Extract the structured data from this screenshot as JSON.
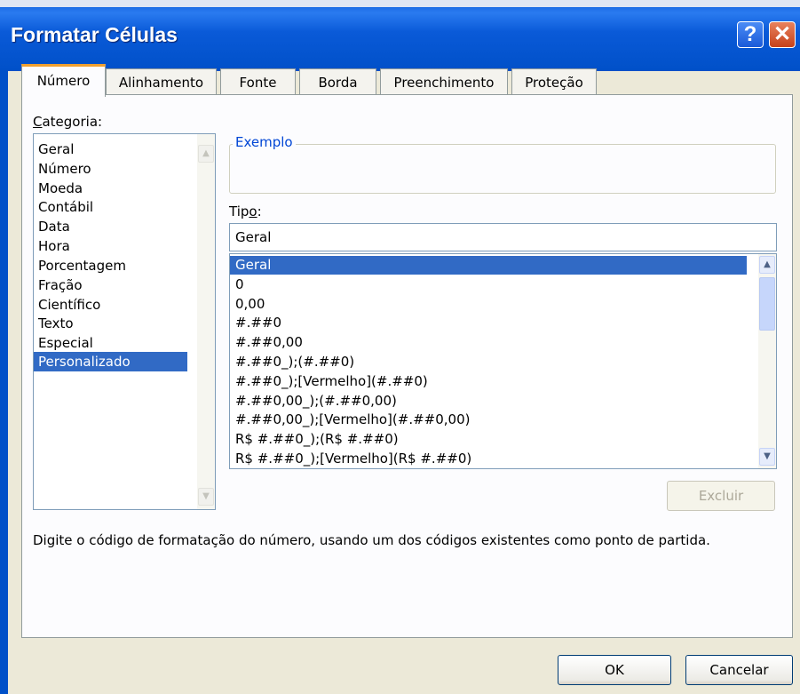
{
  "window": {
    "title": "Formatar Células",
    "help_glyph": "?",
    "close_glyph": "✕"
  },
  "tabs": [
    {
      "label": "Número",
      "active": true
    },
    {
      "label": "Alinhamento"
    },
    {
      "label": "Fonte"
    },
    {
      "label": "Borda"
    },
    {
      "label": "Preenchimento"
    },
    {
      "label": "Proteção"
    }
  ],
  "categoria": {
    "label_prefix": "C",
    "label_rest": "ategoria:",
    "items": [
      "Geral",
      "Número",
      "Moeda",
      "Contábil",
      "Data",
      "Hora",
      "Porcentagem",
      "Fração",
      "Científico",
      "Texto",
      "Especial",
      "Personalizado"
    ],
    "selected": "Personalizado"
  },
  "exemplo": {
    "label": "Exemplo"
  },
  "tipo": {
    "label_prefix": "Tip",
    "label_underlined": "o",
    "label_suffix": ":",
    "value": "Geral",
    "formats": [
      "Geral",
      "0",
      "0,00",
      "#.##0",
      "#.##0,00",
      "#.##0_);(#.##0)",
      "#.##0_);[Vermelho](#.##0)",
      "#.##0,00_);(#.##0,00)",
      "#.##0,00_);[Vermelho](#.##0,00)",
      "R$ #.##0_);(R$ #.##0)",
      "R$ #.##0_);[Vermelho](R$ #.##0)"
    ],
    "selected": "Geral"
  },
  "buttons": {
    "excluir": "Excluir",
    "ok": "OK",
    "cancelar": "Cancelar"
  },
  "description": "Digite o código de formatação do número, usando um dos códigos existentes como ponto de partida.",
  "colors": {
    "selection": "#316ac5",
    "title_bar": "#0a5ad8",
    "group_label": "#0046d5"
  }
}
